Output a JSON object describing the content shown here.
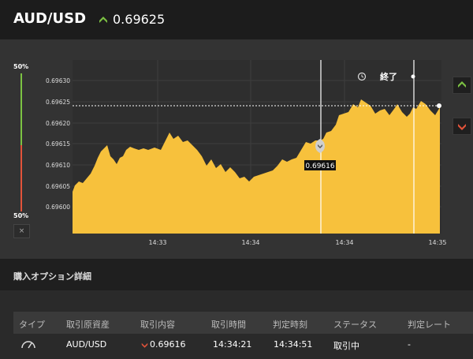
{
  "header": {
    "pair": "AUD/USD",
    "price": "0.69625",
    "direction": "up"
  },
  "gauge": {
    "top_label": "50%",
    "bottom_label": "50%",
    "close_label": "×",
    "up_percent": 50,
    "down_percent": 50
  },
  "chart": {
    "end_label": "終了",
    "entry_price": "0.69616",
    "current_price_line": 0.69624,
    "y_ticks": [
      "0.69630",
      "0.69625",
      "0.69620",
      "0.69615",
      "0.69610",
      "0.69605",
      "0.69600"
    ],
    "x_ticks": [
      "14:33",
      "14:34",
      "14:34",
      "14:35"
    ],
    "colors": {
      "area": "#f7c13c",
      "up": "#7cc242",
      "down": "#e2533a"
    }
  },
  "side_buttons": {
    "high_icon": "up-chevron-icon",
    "low_icon": "down-chevron-icon"
  },
  "section": {
    "title": "購入オプション詳細"
  },
  "table": {
    "headers": [
      "タイプ",
      "取引原資産",
      "取引内容",
      "取引時間",
      "判定時刻",
      "ステータス",
      "判定レート"
    ],
    "row": {
      "type_icon": "speedometer-icon",
      "asset": "AUD/USD",
      "direction": "down",
      "content": "0.69616",
      "trade_time": "14:34:21",
      "judge_time": "14:34:51",
      "status": "取引中",
      "rate": "-"
    }
  }
}
